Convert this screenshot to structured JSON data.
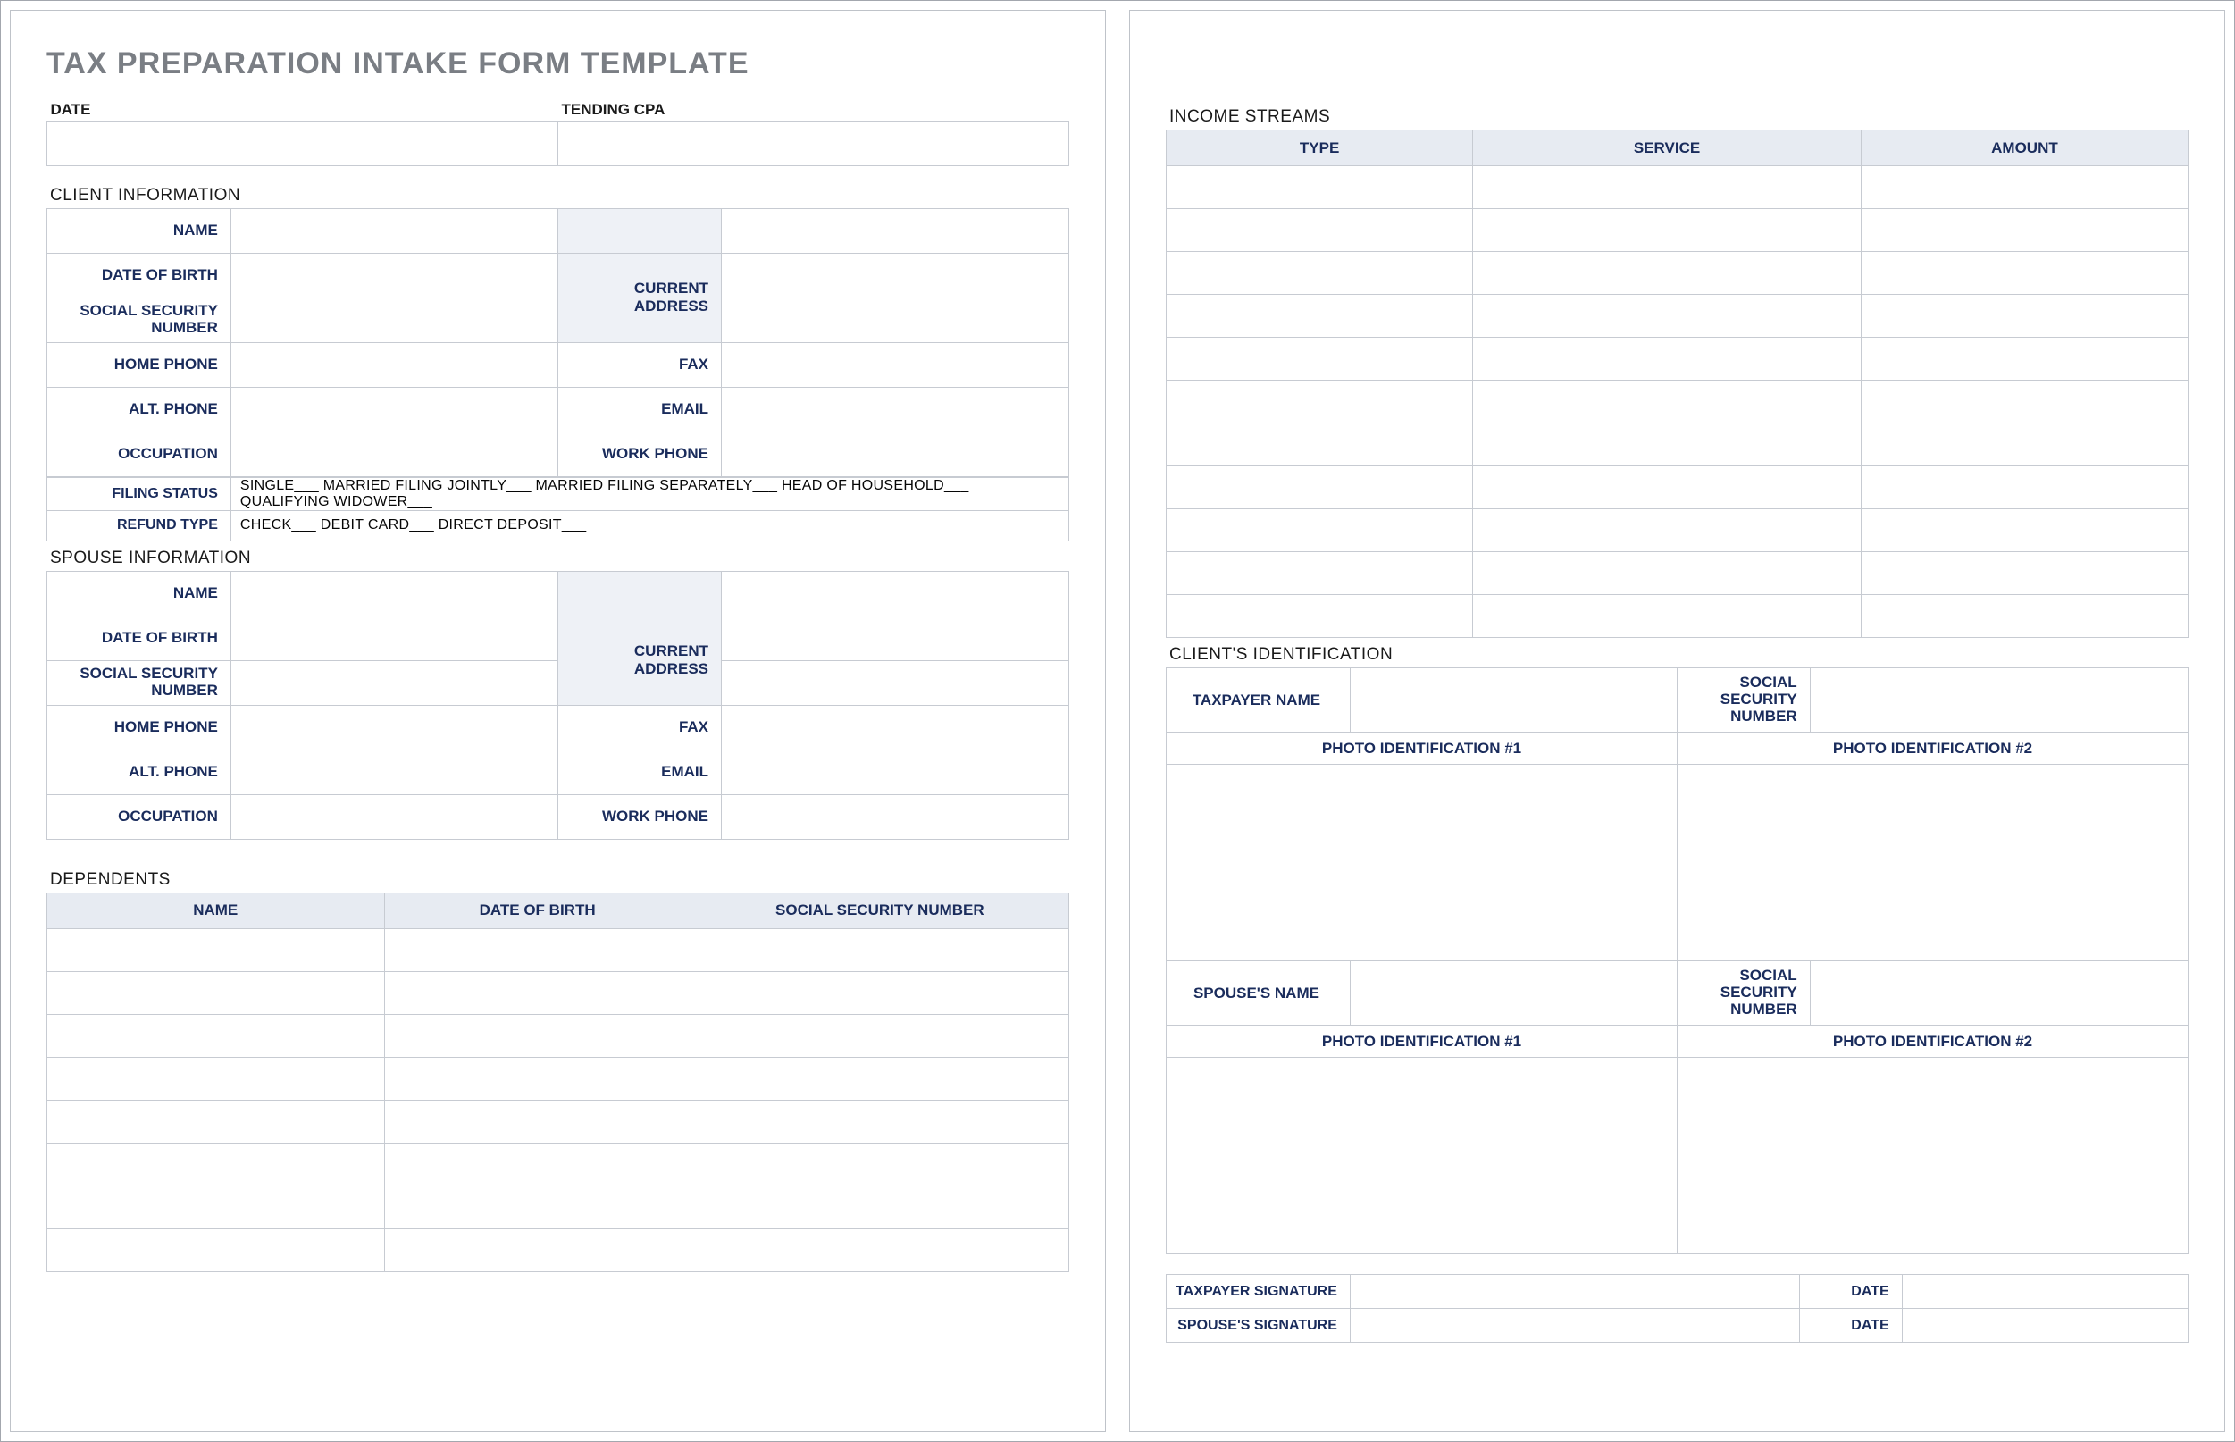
{
  "title": "TAX PREPARATION INTAKE FORM TEMPLATE",
  "dateRow": {
    "dateLabel": "DATE",
    "tendingLabel": "TENDING CPA"
  },
  "sections": {
    "clientInfo": "CLIENT INFORMATION",
    "spouseInfo": "SPOUSE INFORMATION",
    "dependents": "DEPENDENTS",
    "incomeStreams": "INCOME STREAMS",
    "clientId": "CLIENT'S IDENTIFICATION"
  },
  "labels": {
    "name": "NAME",
    "dob": "DATE OF BIRTH",
    "ssn": "SOCIAL SECURITY NUMBER",
    "homePhone": "HOME PHONE",
    "altPhone": "ALT. PHONE",
    "occupation": "OCCUPATION",
    "filingStatus": "FILING STATUS",
    "refundType": "REFUND TYPE",
    "currentAddress": "CURRENT ADDRESS",
    "fax": "FAX",
    "email": "EMAIL",
    "workPhone": "WORK PHONE",
    "taxpayerName": "TAXPAYER NAME",
    "spouseName": "SPOUSE'S NAME",
    "ssnShort": "SOCIAL SECURITY NUMBER",
    "photoId1": "PHOTO IDENTIFICATION #1",
    "photoId2": "PHOTO IDENTIFICATION #2",
    "taxpayerSig": "TAXPAYER SIGNATURE",
    "spouseSig": "SPOUSE'S SIGNATURE",
    "dateShort": "DATE"
  },
  "filingStatusText": "SINGLE___   MARRIED FILING JOINTLY___   MARRIED FILING SEPARATELY___   HEAD OF HOUSEHOLD___   QUALIFYING WIDOWER___",
  "refundTypeText": "CHECK___    DEBIT CARD___    DIRECT DEPOSIT___",
  "dependentsHeaders": {
    "name": "NAME",
    "dob": "DATE OF BIRTH",
    "ssn": "SOCIAL SECURITY NUMBER"
  },
  "incomeHeaders": {
    "type": "TYPE",
    "service": "SERVICE",
    "amount": "AMOUNT"
  }
}
